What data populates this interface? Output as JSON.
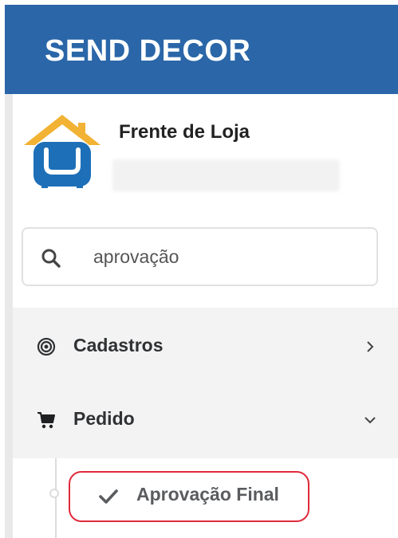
{
  "header": {
    "brand": "SEND DECOR",
    "background_color": "#2a66a8"
  },
  "profile": {
    "store_name": "Frente de Loja",
    "logo_icon": "sofa-house-logo-icon"
  },
  "search": {
    "value": "aprovação",
    "icon": "search-icon"
  },
  "menu": {
    "items": [
      {
        "label": "Cadastros",
        "icon": "target-circle-icon",
        "chevron": "chevron-right-icon"
      },
      {
        "label": "Pedido",
        "icon": "shopping-cart-icon",
        "chevron": "chevron-down-icon"
      }
    ],
    "submenu": [
      {
        "label": "Aprovação Final",
        "icon": "check-icon",
        "highlight_color": "#e0293a"
      }
    ]
  }
}
